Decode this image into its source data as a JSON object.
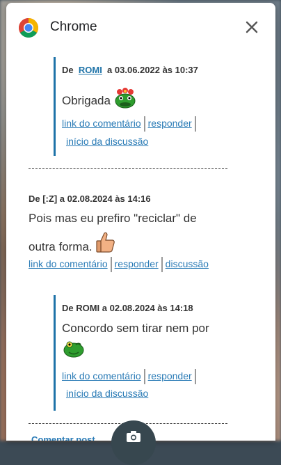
{
  "app": {
    "title": "Chrome"
  },
  "comments": {
    "first": {
      "prefix": "De",
      "author": "ROMI",
      "date": "a 03.06.2022 às 10:37",
      "text": "Obrigada",
      "links": {
        "permalink": "link do comentário",
        "reply": "responder",
        "thread_start": "início da discussão"
      }
    },
    "second": {
      "header": "De [:Z] a 02.08.2024 às 14:16",
      "text_line1": "Pois mas eu prefiro \"reciclar\" de",
      "text_line2": "outra forma.",
      "links": {
        "permalink": "link do comentário",
        "reply": "responder",
        "thread": "discussão"
      }
    },
    "third": {
      "header": "De ROMI a 02.08.2024 às 14:18",
      "text": "Concordo sem tirar nem por",
      "links": {
        "permalink": "link do comentário",
        "reply": "responder",
        "thread_start": "início da discussão"
      }
    }
  },
  "footer": {
    "comment_link": "Comentar post"
  },
  "icons": [
    "chrome-icon",
    "close-icon",
    "flower-frog-emoji-icon",
    "thumbs-up-icon",
    "winking-frog-emoji-icon",
    "camera-icon"
  ]
}
